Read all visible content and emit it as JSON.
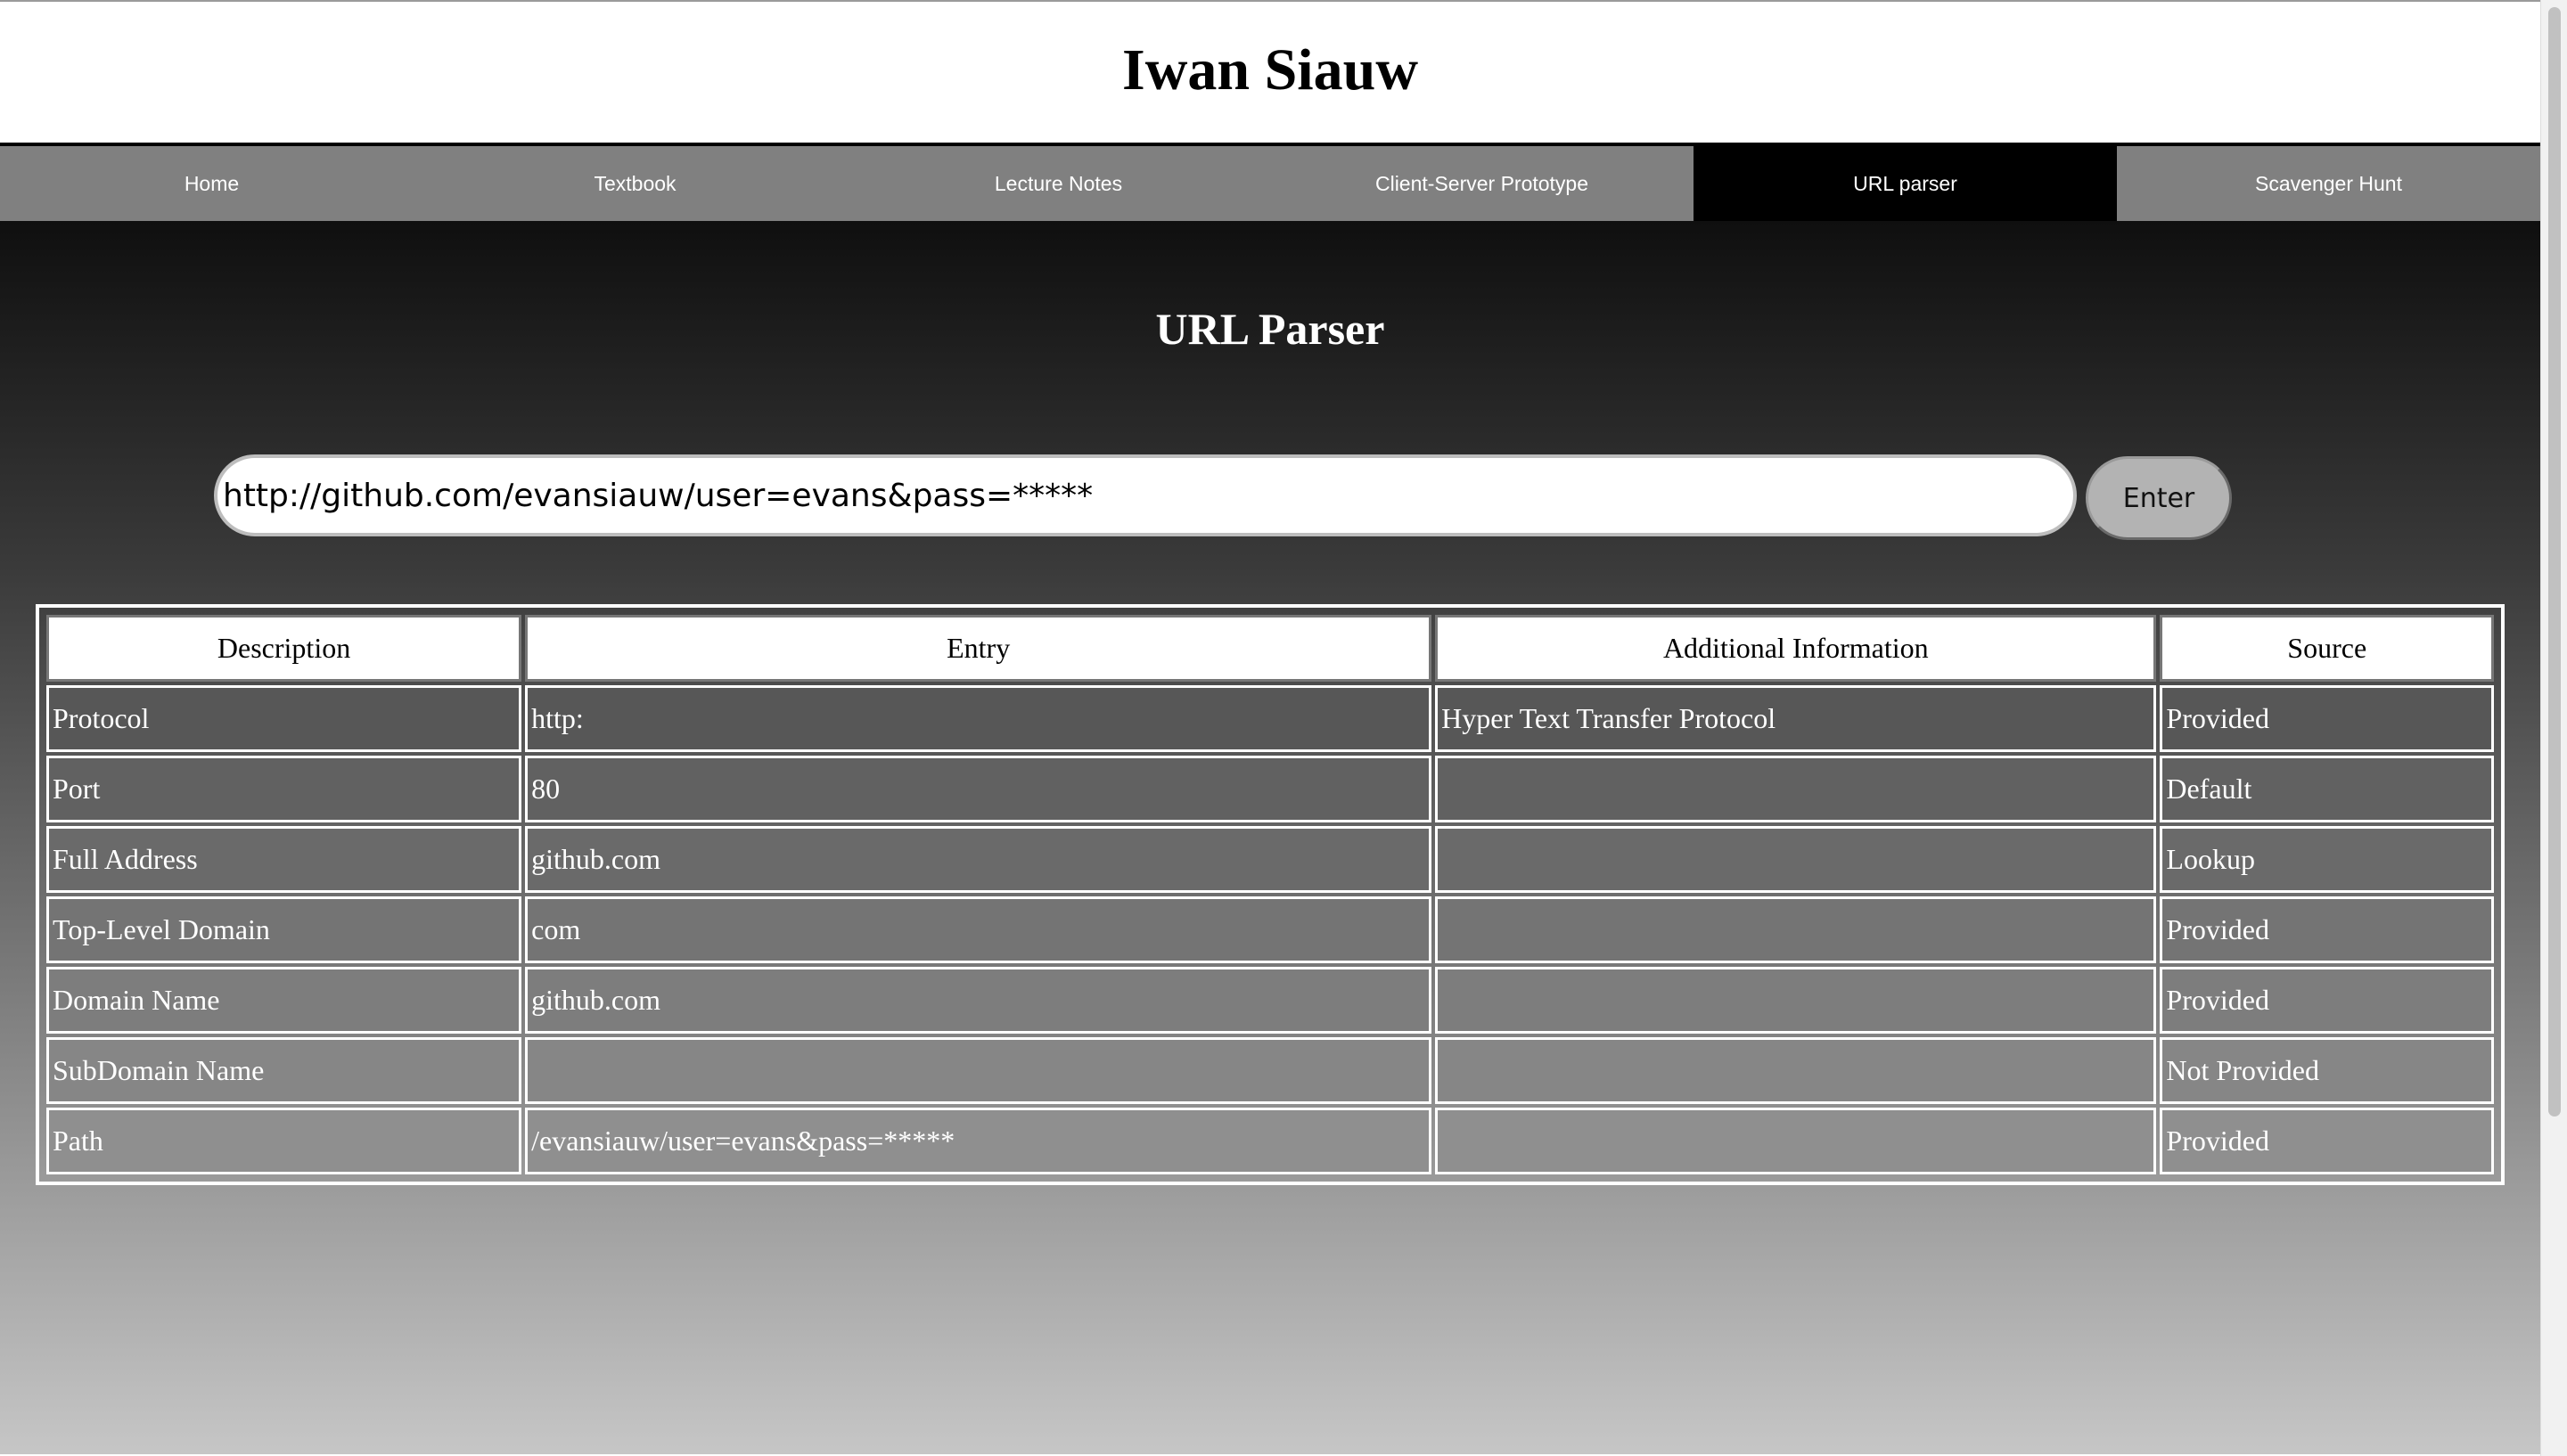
{
  "site": {
    "title": "Iwan Siauw"
  },
  "nav": {
    "items": [
      {
        "label": "Home",
        "active": false
      },
      {
        "label": "Textbook",
        "active": false
      },
      {
        "label": "Lecture Notes",
        "active": false
      },
      {
        "label": "Client-Server Prototype",
        "active": false
      },
      {
        "label": "URL parser",
        "active": true
      },
      {
        "label": "Scavenger Hunt",
        "active": false
      }
    ]
  },
  "main": {
    "heading": "URL Parser",
    "url_input": {
      "value": "http://github.com/evansiauw/user=evans&pass=*****"
    },
    "enter_label": "Enter"
  },
  "table": {
    "headers": [
      "Description",
      "Entry",
      "Additional Information",
      "Source"
    ],
    "rows": [
      [
        "Protocol",
        "http:",
        "Hyper Text Transfer Protocol",
        "Provided"
      ],
      [
        "Port",
        "80",
        "",
        "Default"
      ],
      [
        "Full Address",
        "github.com",
        "",
        "Lookup"
      ],
      [
        "Top-Level Domain",
        "com",
        "",
        "Provided"
      ],
      [
        "Domain Name",
        "github.com",
        "",
        "Provided"
      ],
      [
        "SubDomain Name",
        "",
        "",
        "Not Provided"
      ],
      [
        "Path",
        "/evansiauw/user=evans&pass=*****",
        "",
        "Provided"
      ]
    ]
  },
  "colors": {
    "nav_bg": "#808080",
    "nav_active_bg": "#000000",
    "header_border": "#000000",
    "row_fills": [
      "#575757",
      "#616161",
      "#6a6a6a",
      "#747474",
      "#7d7d7d",
      "#868686",
      "#8f8f8f"
    ]
  }
}
